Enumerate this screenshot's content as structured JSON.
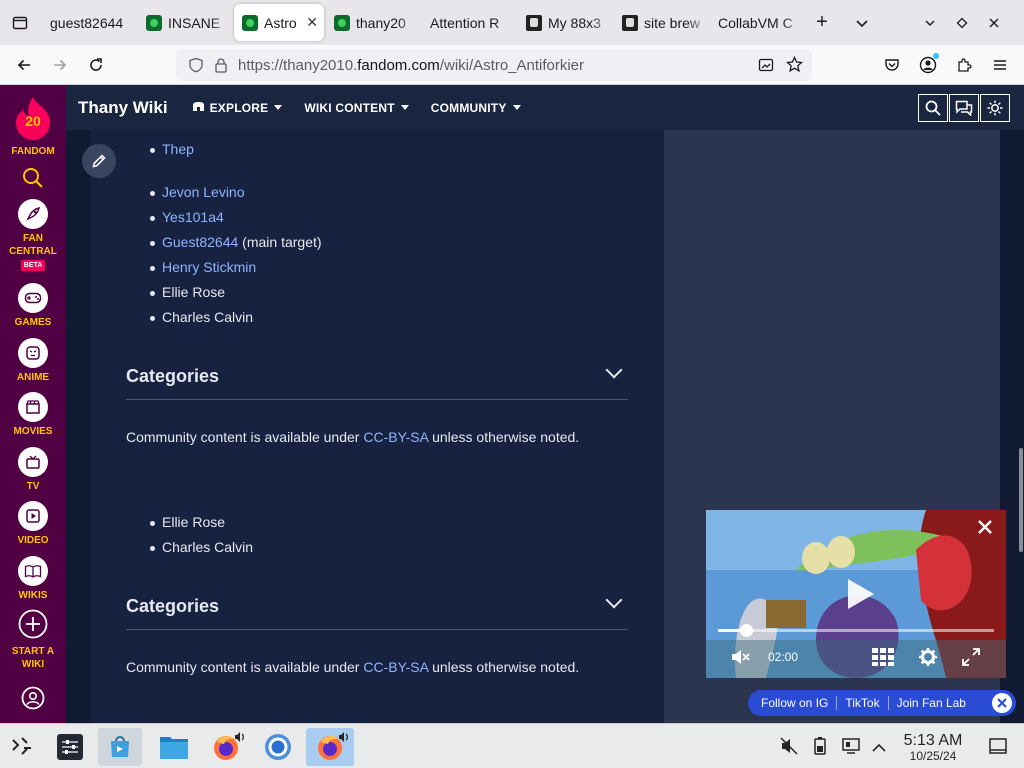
{
  "browser": {
    "tabs": [
      {
        "label": "guest82644",
        "icon": "none"
      },
      {
        "label": "INSANE",
        "icon": "fandom-favicon"
      },
      {
        "label": "Astro",
        "icon": "fandom-favicon",
        "active": true
      },
      {
        "label": "thany20",
        "icon": "fandom-favicon"
      },
      {
        "label": "Attention R",
        "icon": "none"
      },
      {
        "label": "My 88x3",
        "icon": "page-favicon"
      },
      {
        "label": "site brew",
        "icon": "page-favicon"
      },
      {
        "label": "CollabVM C",
        "icon": "none"
      }
    ],
    "url_prefix": "https://thany2010.",
    "url_domain": "fandom.com",
    "url_path": "/wiki/Astro_Antiforkier"
  },
  "rail": {
    "logo_number": "20",
    "logo_label": "FANDOM",
    "items": [
      {
        "label": "FAN CENTRAL",
        "badge": "BETA",
        "icon": "rocket-icon"
      },
      {
        "label": "GAMES",
        "icon": "gamepad-icon"
      },
      {
        "label": "ANIME",
        "icon": "anime-icon"
      },
      {
        "label": "MOVIES",
        "icon": "clapperboard-icon"
      },
      {
        "label": "TV",
        "icon": "tv-icon"
      },
      {
        "label": "VIDEO",
        "icon": "play-icon"
      },
      {
        "label": "WIKIS",
        "icon": "book-icon"
      },
      {
        "label": "START A WIKI",
        "icon": "plus-icon"
      }
    ]
  },
  "wiki": {
    "name": "Thany Wiki",
    "nav": [
      "EXPLORE",
      "WIKI CONTENT",
      "COMMUNITY"
    ]
  },
  "content": {
    "list_top": [
      {
        "text": "Thep",
        "link": true
      }
    ],
    "list_main": [
      {
        "text": "Jevon Levino",
        "link": true,
        "suffix": ""
      },
      {
        "text": "Yes101a4",
        "link": true,
        "suffix": ""
      },
      {
        "text": "Guest82644",
        "link": true,
        "suffix": " (main target)"
      },
      {
        "text": "Henry Stickmin",
        "link": true,
        "suffix": ""
      },
      {
        "text": "Ellie Rose",
        "link": false,
        "suffix": ""
      },
      {
        "text": "Charles Calvin",
        "link": false,
        "suffix": ""
      }
    ],
    "categories_label": "Categories",
    "license_pre": "Community content is available under ",
    "license_link": "CC-BY-SA",
    "license_post": " unless otherwise noted.",
    "list_second": [
      {
        "text": "Ellie Rose"
      },
      {
        "text": "Charles Calvin"
      }
    ]
  },
  "video": {
    "time": "02:00",
    "progress": 0.1
  },
  "social": [
    "Follow on IG",
    "TikTok",
    "Join Fan Lab"
  ],
  "taskbar": {
    "time": "5:13 AM",
    "date": "10/25/24"
  },
  "colors": {
    "rail_bg": "#520044",
    "rail_text": "#ffc500",
    "link": "#8fb4ff",
    "header_bg": "#1a2540"
  }
}
